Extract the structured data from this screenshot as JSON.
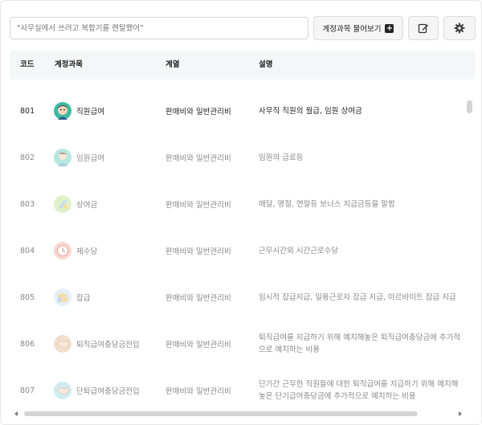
{
  "search": {
    "placeholder": "\"사무실에서 쓰려고 복합기를 렌탈했어\""
  },
  "toolbar": {
    "ask_label": "계정과목 물어보기",
    "ask_icon": "plus-box-icon",
    "edit_icon": "edit-icon",
    "settings_icon": "gear-icon"
  },
  "table": {
    "headers": {
      "code": "코드",
      "account": "계정과목",
      "category": "계열",
      "description": "설명"
    },
    "rows": [
      {
        "code": "801",
        "name": "직원급여",
        "category": "판매비와 일반관리비",
        "description": "사무직 직원의 월급, 임원 상여금",
        "icon": "office-worker-icon",
        "active": true
      },
      {
        "code": "802",
        "name": "임원급여",
        "category": "판매비와 일반관리비",
        "description": "임원의 급료등",
        "icon": "executive-icon",
        "active": false
      },
      {
        "code": "803",
        "name": "상여금",
        "category": "판매비와 일반관리비",
        "description": "매달, 명절, 연말등 보너스 지급금등을 말함",
        "icon": "bonus-icon",
        "active": false
      },
      {
        "code": "804",
        "name": "제수당",
        "category": "판매비와 일반관리비",
        "description": "근무시간외 시간근로수당",
        "icon": "clock-icon",
        "active": false
      },
      {
        "code": "805",
        "name": "잡급",
        "category": "판매비와 일반관리비",
        "description": "임시적 잡급지급, 일용근로자 잡급 지급, 아르바이트 잡급 지급",
        "icon": "puzzle-icon",
        "active": false
      },
      {
        "code": "806",
        "name": "퇴직급여충당금전입",
        "category": "판매비와 일반관리비",
        "description": "퇴직급여를 지급하기 위해 예치해놓은 퇴직급여충당금에 추가적으로 예치하는 비용",
        "icon": "handshake-icon",
        "active": false
      },
      {
        "code": "807",
        "name": "단퇴급여충당금전입",
        "category": "판매비와 일반관리비",
        "description": "단기간 근무한 직원들에 대한 퇴직급여를 지급하기 위해 예치해놓은 단기급여충당금에 추가적으로 예치하는 비용",
        "icon": "handshake-icon",
        "active": false
      }
    ]
  },
  "colors": {
    "header_bg": "#f5f6f7",
    "active_text": "#222222",
    "muted_text": "#888888"
  }
}
